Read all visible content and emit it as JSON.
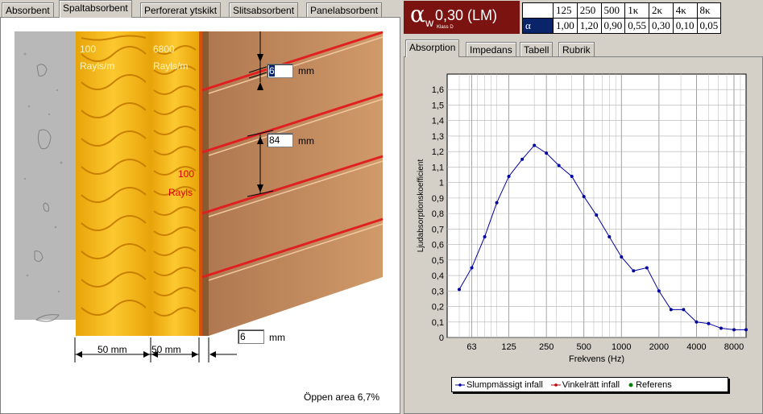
{
  "left_tabs": [
    "Absorbent",
    "Spaltabsorbent",
    "Perforerat ytskikt",
    "Slitsabsorbent",
    "Panelabsorbent"
  ],
  "right_tabs": [
    "Absorption",
    "Impedans",
    "Tabell",
    "Rubrik"
  ],
  "rating": {
    "symbol": "α",
    "subscript": "w",
    "value": "0,30 (LM)",
    "class_label": "Klass D"
  },
  "freq_table": {
    "headers": [
      "125",
      "250",
      "500",
      "1κ",
      "2κ",
      "4κ",
      "8κ"
    ],
    "row_label": "α",
    "values": [
      "1,00",
      "1,20",
      "0,90",
      "0,55",
      "0,30",
      "0,10",
      "0,05"
    ]
  },
  "diagram": {
    "layer1_value": "100",
    "layer1_unit": "Rayls/m",
    "layer2_value": "6800",
    "layer2_unit": "Rayls/m",
    "layer3_value": "100",
    "layer3_unit": "Rayls",
    "slit_width": "6",
    "slit_width_unit": "mm",
    "spacing": "84",
    "spacing_unit": "mm",
    "thickness1": "50 mm",
    "thickness2": "50 mm",
    "panel_thickness": "6",
    "panel_thickness_unit": "mm",
    "open_area": "Öppen area 6,7%"
  },
  "colors": {
    "rating_bg": "#7b1411",
    "line_blue": "#0000a0",
    "wool": "#f0b010",
    "wood": "#c08860",
    "red_slit": "#e02020"
  },
  "chart_data": {
    "type": "line",
    "xlabel": "Frekvens (Hz)",
    "ylabel": "Ljudabsorptionskoefficient",
    "x_scale": "log",
    "xlim": [
      40,
      10000
    ],
    "ylim": [
      0,
      1.7
    ],
    "x_ticks": [
      "63",
      "125",
      "250",
      "500",
      "1000",
      "2000",
      "4000",
      "8000"
    ],
    "x_tick_values": [
      63,
      125,
      250,
      500,
      1000,
      2000,
      4000,
      8000
    ],
    "y_ticks": [
      "0",
      "0,1",
      "0,2",
      "0,3",
      "0,4",
      "0,5",
      "0,6",
      "0,7",
      "0,8",
      "0,9",
      "1",
      "1,1",
      "1,2",
      "1,3",
      "1,4",
      "1,5",
      "1,6"
    ],
    "y_tick_values": [
      0,
      0.1,
      0.2,
      0.3,
      0.4,
      0.5,
      0.6,
      0.7,
      0.8,
      0.9,
      1.0,
      1.1,
      1.2,
      1.3,
      1.4,
      1.5,
      1.6
    ],
    "grid": true,
    "legend_position": "bottom",
    "series": [
      {
        "name": "Slumpmässigt infall",
        "color": "#0000a0",
        "x": [
          50,
          63,
          80,
          100,
          125,
          160,
          200,
          250,
          315,
          400,
          500,
          630,
          800,
          1000,
          1250,
          1600,
          2000,
          2500,
          3150,
          4000,
          5000,
          6300,
          8000,
          10000
        ],
        "y": [
          0.31,
          0.45,
          0.65,
          0.87,
          1.04,
          1.15,
          1.24,
          1.19,
          1.11,
          1.04,
          0.91,
          0.79,
          0.65,
          0.52,
          0.43,
          0.45,
          0.3,
          0.18,
          0.18,
          0.1,
          0.09,
          0.06,
          0.05,
          0.05
        ]
      },
      {
        "name": "Vinkelrätt infall",
        "color": "#c00000",
        "x": [],
        "y": []
      },
      {
        "name": "Referens",
        "color": "#008000",
        "x": [],
        "y": []
      }
    ]
  }
}
